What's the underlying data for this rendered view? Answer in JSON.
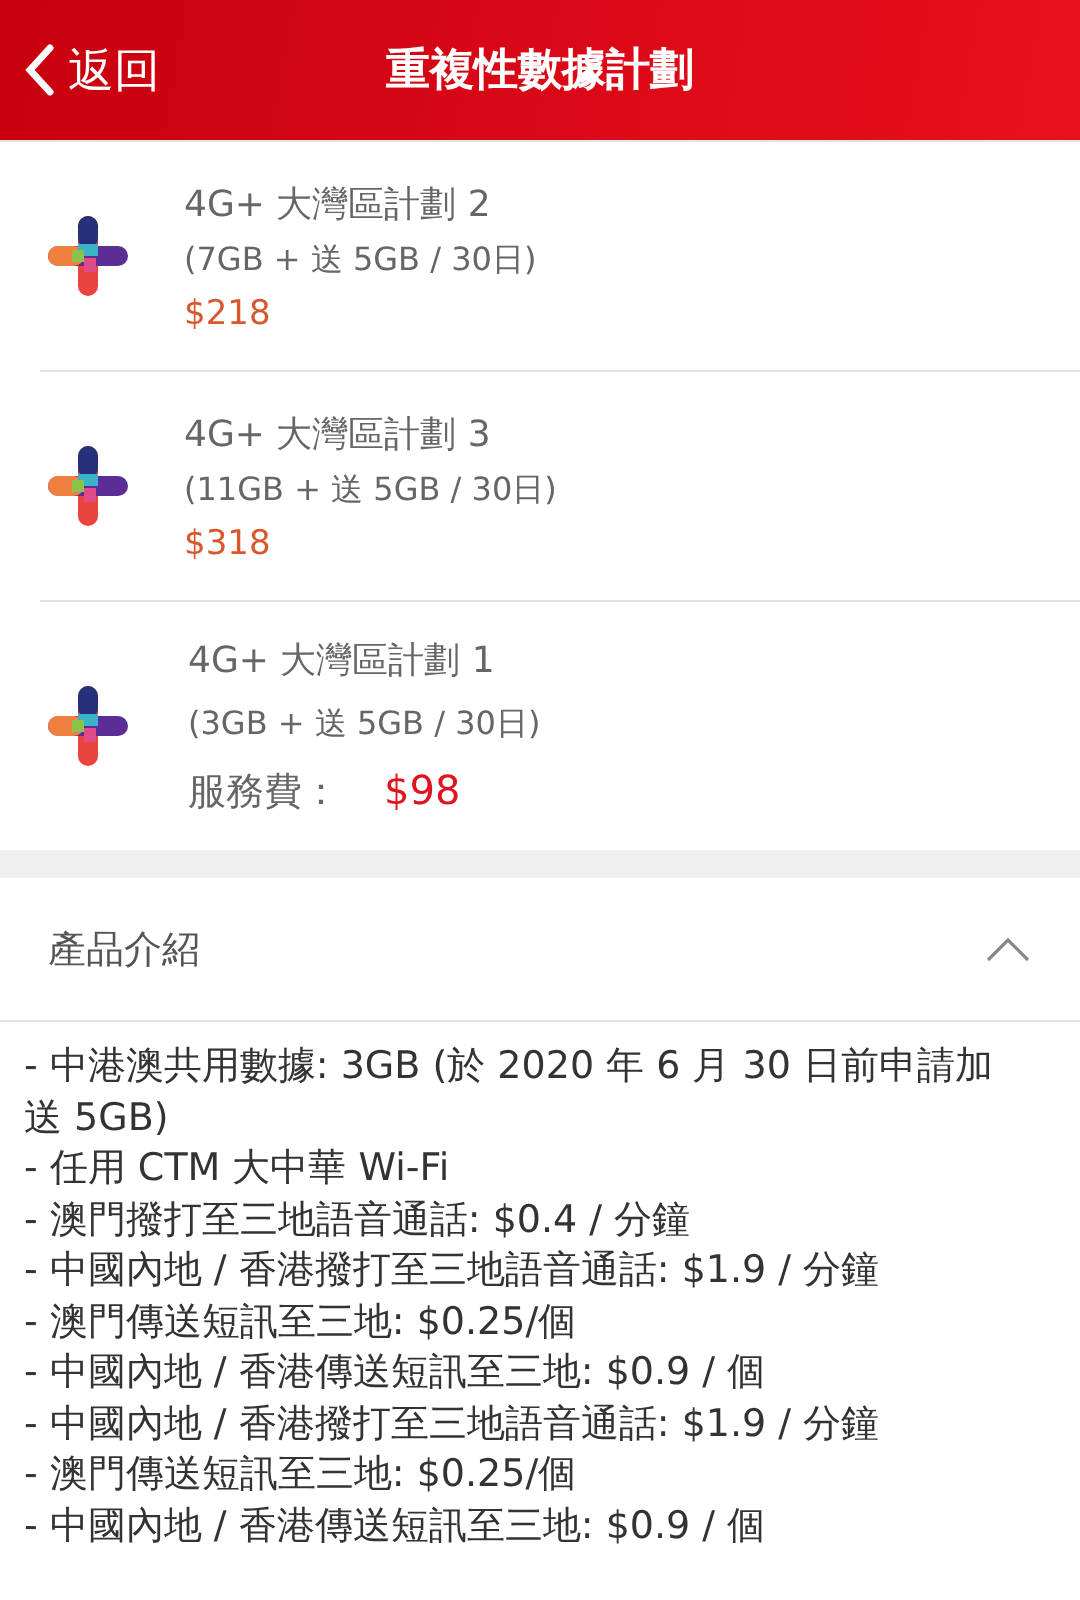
{
  "header": {
    "back_label": "返回",
    "title": "重複性數據計劃"
  },
  "plans": [
    {
      "kind": "price",
      "name": "4G+ 大灣區計劃 2",
      "detail": "(7GB + 送 5GB / 30日)",
      "price": "$218"
    },
    {
      "kind": "price",
      "name": "4G+ 大灣區計劃 3",
      "detail": "(11GB + 送 5GB / 30日)",
      "price": "$318"
    },
    {
      "kind": "fee",
      "name": "4G+ 大灣區計劃 1",
      "detail": "(3GB + 送 5GB / 30日)",
      "fee_label": "服務費：",
      "price": "$98"
    }
  ],
  "intro": {
    "title": "產品介紹",
    "expanded": true,
    "lines": [
      "- 中港澳共用數據: 3GB (於 2020 年 6 月 30 日前申請加送 5GB)",
      "- 任用 CTM 大中華 Wi-Fi",
      "- 澳門撥打至三地語音通話: $0.4 / 分鐘",
      "- 中國內地 / 香港撥打至三地語音通話: $1.9 / 分鐘",
      "- 澳門傳送短訊至三地: $0.25/個",
      "- 中國內地 / 香港傳送短訊至三地: $0.9 / 個",
      "- 中國內地 / 香港撥打至三地語音通話: $1.9 / 分鐘",
      "- 澳門傳送短訊至三地: $0.25/個",
      "- 中國內地 / 香港傳送短訊至三地: $0.9 / 個"
    ]
  }
}
